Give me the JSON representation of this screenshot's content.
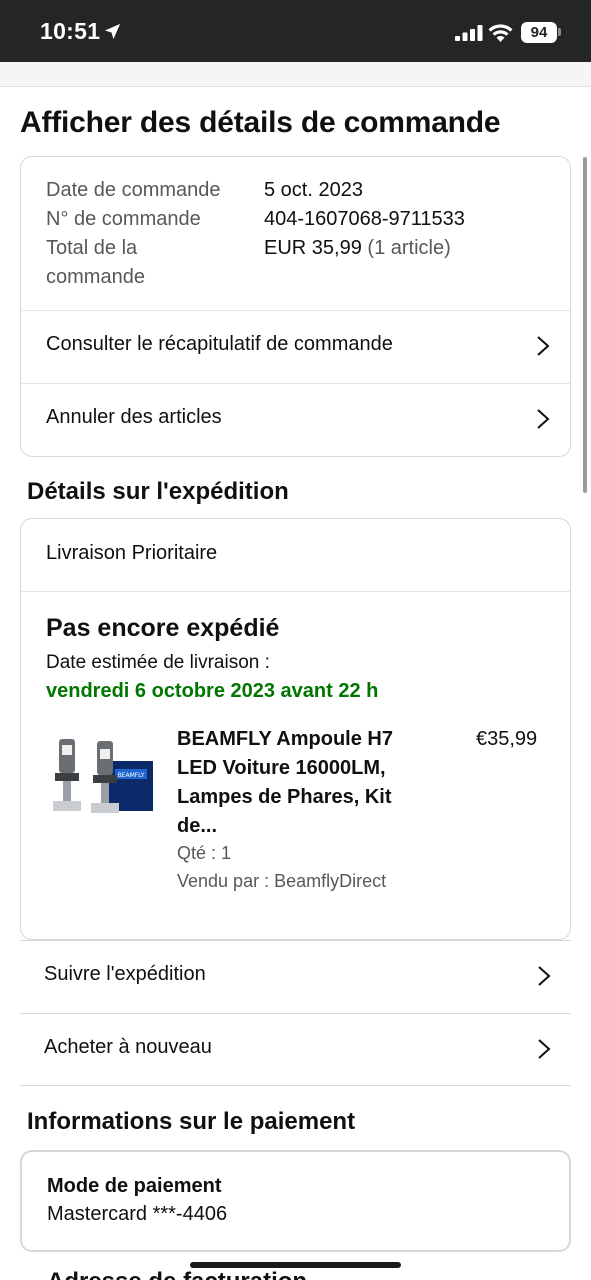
{
  "status_bar": {
    "time": "10:51",
    "battery": "94"
  },
  "page": {
    "title": "Afficher des détails de commande"
  },
  "summary": {
    "order_date_label": "Date de commande",
    "order_date_value": "5 oct. 2023",
    "order_number_label": "N° de commande",
    "order_number_value": "404-1607068-9711533",
    "total_label_1": "Total de la",
    "total_label_2": "commande",
    "total_value": "EUR 35,99",
    "total_items": "(1 article)",
    "view_summary_label": "Consulter le récapitulatif de commande",
    "cancel_items_label": "Annuler des articles"
  },
  "shipping": {
    "section_title": "Détails sur l'expédition",
    "method": "Livraison Prioritaire",
    "status": "Pas encore expédié",
    "estimated_label": "Date estimée de livraison :",
    "estimated_date": "vendredi 6 octobre 2023 avant 22 h",
    "product": {
      "title_line1": "BEAMFLY Ampoule H7",
      "title_line2": "LED Voiture 16000LM,",
      "title_line3": "Lampes de Phares, Kit",
      "title_line4": "de...",
      "price": "€35,99",
      "quantity": "Qté : 1",
      "seller": "Vendu par : BeamflyDirect",
      "box_brand": "BEAMFLY"
    },
    "track_label": "Suivre l'expédition",
    "buy_again_label": "Acheter à nouveau"
  },
  "payment": {
    "section_title": "Informations sur le paiement",
    "method_label": "Mode de paiement",
    "method_value": "Mastercard  ***-4406",
    "next_heading_partial": "Adresse de facturation"
  },
  "colors": {
    "status_bar": "#232527",
    "delivery_green": "#007600",
    "border": "#d5d9d9",
    "text": "#0f1111",
    "muted": "#565959"
  }
}
